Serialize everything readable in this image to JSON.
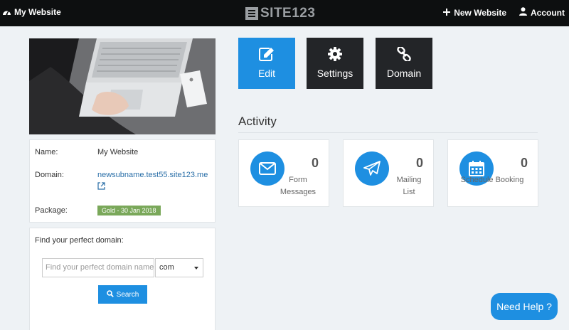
{
  "topbar": {
    "site_label": "My Website",
    "logo_text": "SITE123",
    "new_website_label": "New Website",
    "account_label": "Account"
  },
  "info": {
    "name_label": "Name:",
    "name_value": "My Website",
    "domain_label": "Domain:",
    "domain_value": "newsubname.test55.site123.me",
    "package_label": "Package:",
    "package_value": "Gold - 30 Jan 2018"
  },
  "domain_search": {
    "title": "Find your perfect domain:",
    "placeholder": "Find your perfect domain name",
    "tld_selected": "com",
    "search_label": "Search"
  },
  "actions": {
    "edit_label": "Edit",
    "settings_label": "Settings",
    "domain_label": "Domain"
  },
  "activity": {
    "title": "Activity",
    "stats": [
      {
        "count": "0",
        "label": "Form Messages",
        "icon": "envelope-icon"
      },
      {
        "count": "0",
        "label": "Mailing List",
        "icon": "paper-plane-icon"
      },
      {
        "count": "0",
        "label": "Schedule Booking",
        "icon": "calendar-icon"
      }
    ]
  },
  "help": {
    "label": "Need Help ?"
  },
  "colors": {
    "accent": "#1e8fe1",
    "dark_button": "#232528",
    "topbar": "#0d0f10",
    "badge": "#7aa85a",
    "background": "#eef2f5"
  }
}
